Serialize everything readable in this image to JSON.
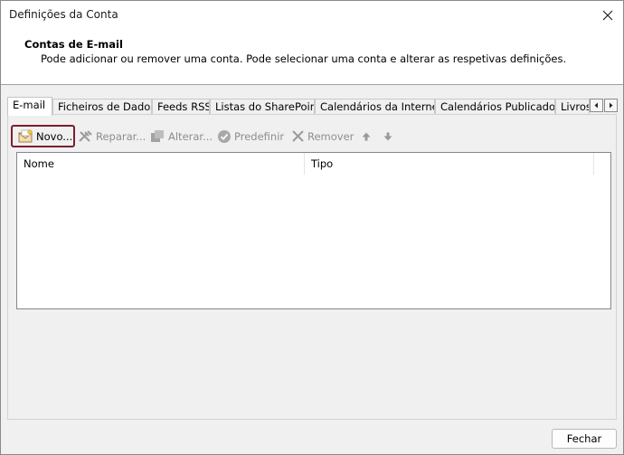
{
  "window": {
    "title": "Definições da Conta",
    "close_icon": "close-icon"
  },
  "header": {
    "title": "Contas de E-mail",
    "description": "Pode adicionar ou remover uma conta. Pode selecionar uma conta e alterar as respetivas definições."
  },
  "tabs": [
    {
      "label": "E-mail",
      "active": true
    },
    {
      "label": "Ficheiros de Dados",
      "active": false
    },
    {
      "label": "Feeds RSS",
      "active": false
    },
    {
      "label": "Listas do SharePoint",
      "active": false
    },
    {
      "label": "Calendários da Internet",
      "active": false
    },
    {
      "label": "Calendários Publicados",
      "active": false
    },
    {
      "label": "Livros",
      "active": false
    }
  ],
  "toolbar": {
    "new_label": "Novo...",
    "repair_label": "Reparar...",
    "change_label": "Alterar...",
    "default_label": "Predefinir",
    "remove_label": "Remover"
  },
  "list": {
    "columns": [
      "Nome",
      "Tipo"
    ],
    "rows": []
  },
  "footer": {
    "close_label": "Fechar"
  },
  "colors": {
    "highlight_border": "#7a1f2e",
    "disabled_text": "#8d8d8d",
    "window_bg": "#f0f0f0"
  }
}
